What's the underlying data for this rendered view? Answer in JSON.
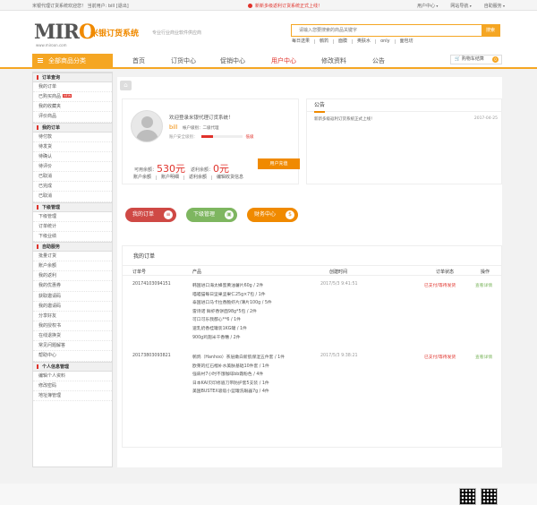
{
  "topbar": {
    "left": "米银代理订货系统欢迎您！ 当前用户: bill [退出]",
    "announcement": "新新多级返利订货系统正式上线！",
    "links": [
      "用户中心",
      "网站导航",
      "自助服务"
    ]
  },
  "logo": {
    "brand": "MIRO",
    "url": "www.miroon.com",
    "system": "米银订货系统",
    "slogan": "专业行业商业软件供应商"
  },
  "search": {
    "placeholder": "请输入您要搜索的商品关键字",
    "button": "搜索"
  },
  "hot_keywords": [
    "每日送果",
    "鹌鹑",
    "面膜",
    "奥肤水",
    "only",
    "面包坊"
  ],
  "nav": {
    "all_categories": "全部商品分类",
    "items": [
      "首页",
      "订货中心",
      "促销中心",
      "用户中心",
      "修改资料",
      "公告"
    ],
    "active": "用户中心",
    "cart_label": "购物车结算",
    "cart_count": "0"
  },
  "sidebar": {
    "groups": [
      {
        "title": "订单查询",
        "items": [
          "我的订单",
          "已购买商品",
          "我的收藏夹",
          "评价商品"
        ]
      },
      {
        "title": "我的订单",
        "items": [
          "待付款",
          "待发货",
          "待确认",
          "待评价",
          "已取消",
          "已完成",
          "已取消"
        ]
      },
      {
        "title": "下级管理",
        "items": [
          "下级管理",
          "订单统计",
          "下级业绩"
        ]
      },
      {
        "title": "自助服务",
        "items": [
          "批量订货",
          "账户余额",
          "我的返利",
          "我的优惠券",
          "获取邀请码",
          "我的邀请码",
          "分享好友",
          "我的授权书",
          "在线退换货",
          "常见问题解答",
          "帮助中心"
        ]
      },
      {
        "title": "个人信息管理",
        "items": [
          "编辑个人资料",
          "修改密码",
          "地址簿管理"
        ]
      }
    ],
    "new_badge": "NEW"
  },
  "user_card": {
    "welcome": "欢迎登录米银代理订货系统！",
    "username": "bill",
    "level": "帐户级别：二级代理",
    "security_label": "账户安全级别：",
    "security_level_text": "低级",
    "security_level_fraction": 0.3,
    "balance_label": "可用余额：",
    "balance": "530元",
    "rebate_label": "返利余额：",
    "rebate": "0元",
    "recharge_button": "用户充值",
    "links": [
      "账户余额",
      "账户明细",
      "返利余额",
      "编辑收货信息"
    ]
  },
  "notice": {
    "title": "公告",
    "items": [
      {
        "text": "新新多级返利订货系统正式上线！",
        "date": "2017-04-25"
      }
    ]
  },
  "quick": [
    {
      "label": "我的订单",
      "icon": "≡"
    },
    {
      "label": "下级管理",
      "icon": "▣"
    },
    {
      "label": "财务中心",
      "icon": "$"
    }
  ],
  "orders": {
    "title": "我的订单",
    "headers": [
      "订单号",
      "产品",
      "创建时间",
      "订单状态",
      "操作"
    ],
    "rows": [
      {
        "no": "20174103094151",
        "products": [
          "韩国进口海太蜂蜜黄油薯片60g / 2件",
          "喵喵猫每日坚果坚果仁25g×7包 / 1件",
          "泰国进口马卡拉香脆虾片/薄片100g / 5件",
          "雷诗诺 鲜虾香饼面98g*5包 / 2件",
          "可口可乐我都心**6 / 1件",
          "速乳奶香桂罐装1KG罐 / 1件",
          "900g鸡翅米干香糟 / 2件"
        ],
        "time": "2017/5/3 9:41:51",
        "status": "已支付/等待发货",
        "op": "查看详情"
      },
      {
        "no": "20173803093821",
        "products": [
          "鹌鹑（Hanhoo）茶层嫩白新肌保湿五件套 / 1件",
          "欧莱的红石榴补水美肤基础10件套 / 1件",
          "强肩村7小时不饿咖啡bb霜粉色 / 4件",
          "日本KAI贝印修眉刀带防护套5支装 / 1件",
          "美国BUSTEX吸吸小蓝罐洗眼器7g / 4件"
        ],
        "time": "2017/5/3 9:38:21",
        "status": "已支付/等待发货",
        "op": "查看详情"
      }
    ]
  }
}
